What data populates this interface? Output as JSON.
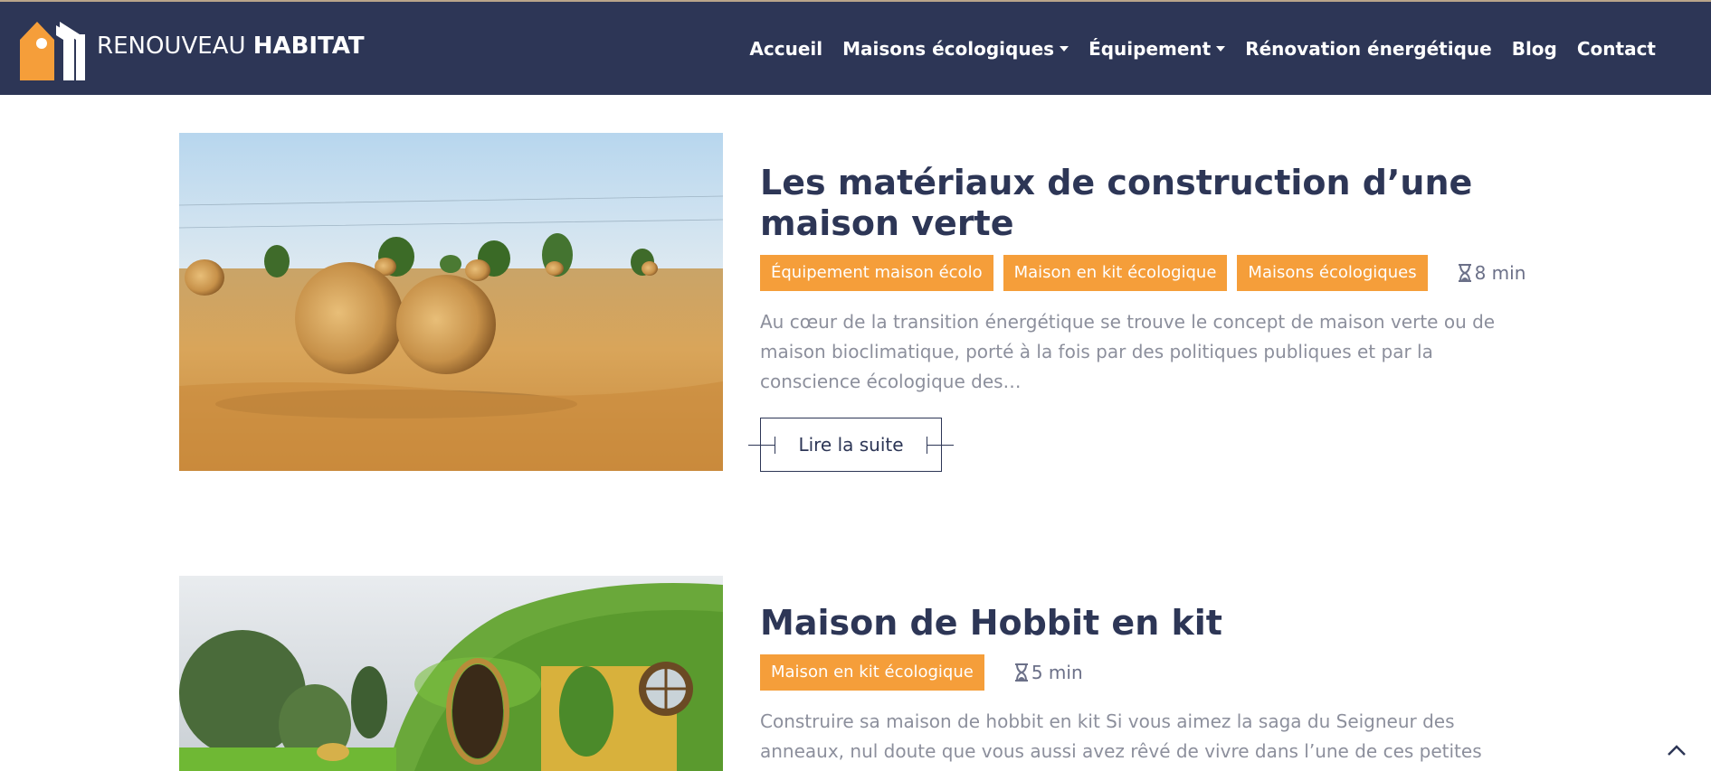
{
  "brand": {
    "light": "RENOUVEAU",
    "bold": "HABITAT"
  },
  "nav": {
    "items": [
      {
        "label": "Accueil",
        "dropdown": false
      },
      {
        "label": "Maisons écologiques",
        "dropdown": true
      },
      {
        "label": "Équipement",
        "dropdown": true
      },
      {
        "label": "Rénovation énergétique",
        "dropdown": false
      },
      {
        "label": "Blog",
        "dropdown": false
      },
      {
        "label": "Contact",
        "dropdown": false
      }
    ]
  },
  "posts": [
    {
      "title": "Les matériaux de construction d’une maison verte",
      "tags": [
        "Équipement maison écolo",
        "Maison en kit écologique",
        "Maisons écologiques"
      ],
      "read_time": "8 min",
      "excerpt": "Au cœur de la transition énergétique se trouve le concept de maison verte ou de maison bioclimatique, porté à la fois par des politiques publiques et par la conscience écologique des…",
      "button": "Lire la suite"
    },
    {
      "title": "Maison de Hobbit en kit",
      "tags": [
        "Maison en kit écologique"
      ],
      "read_time": "5 min",
      "excerpt": "Construire sa maison de hobbit en kit Si vous aimez la saga du Seigneur des anneaux, nul doute que vous aussi avez rêvé de vivre dans l’une de ces petites maisons cosy,"
    }
  ],
  "colors": {
    "navy": "#2d3656",
    "orange": "#f59e3a",
    "text_muted": "#8c8f9c"
  },
  "icons": {
    "logo": "house-logo-icon",
    "time": "hourglass-icon",
    "scroll": "chevron-up-icon"
  }
}
